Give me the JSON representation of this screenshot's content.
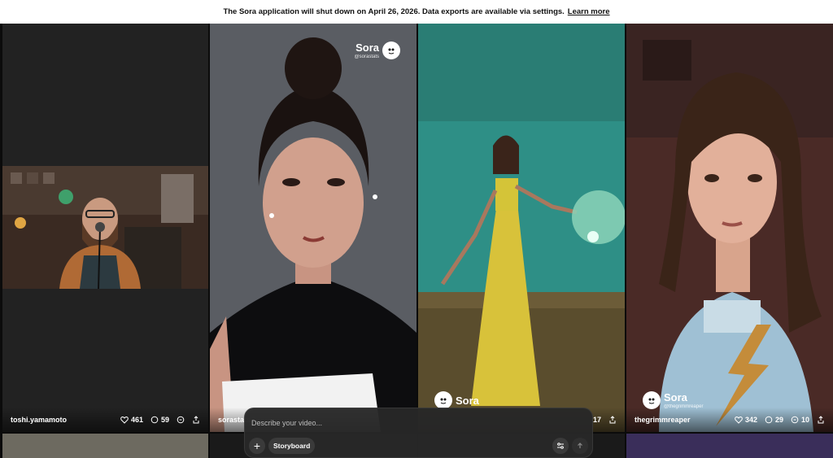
{
  "banner": {
    "message": "The Sora application will shut down on April 26, 2026. Data exports are available via settings.",
    "link_label": "Learn more"
  },
  "feed": {
    "tiles": [
      {
        "username": "toshi.yamamoto",
        "likes": "461",
        "comments": "59",
        "remixes": "",
        "watermark": null
      },
      {
        "username": "sorastats",
        "likes": "",
        "comments": "",
        "remixes": "",
        "watermark": {
          "name": "Sora",
          "handle": "@sorastats"
        }
      },
      {
        "username": "",
        "likes": "",
        "comments": "",
        "remixes": "17",
        "watermark": {
          "name": "Sora",
          "handle": ""
        }
      },
      {
        "username": "thegrimmreaper",
        "likes": "342",
        "comments": "29",
        "remixes": "10",
        "watermark": {
          "name": "Sora",
          "handle": "@thegrimmreaper"
        }
      }
    ]
  },
  "composer": {
    "placeholder": "Describe your video...",
    "plus_label": "+",
    "storyboard_label": "Storyboard"
  },
  "icons": [
    "heart-icon",
    "comment-icon",
    "remix-icon",
    "share-icon",
    "sora-logo-icon",
    "plus-icon",
    "settings-sliders-icon",
    "send-arrow-icon"
  ]
}
